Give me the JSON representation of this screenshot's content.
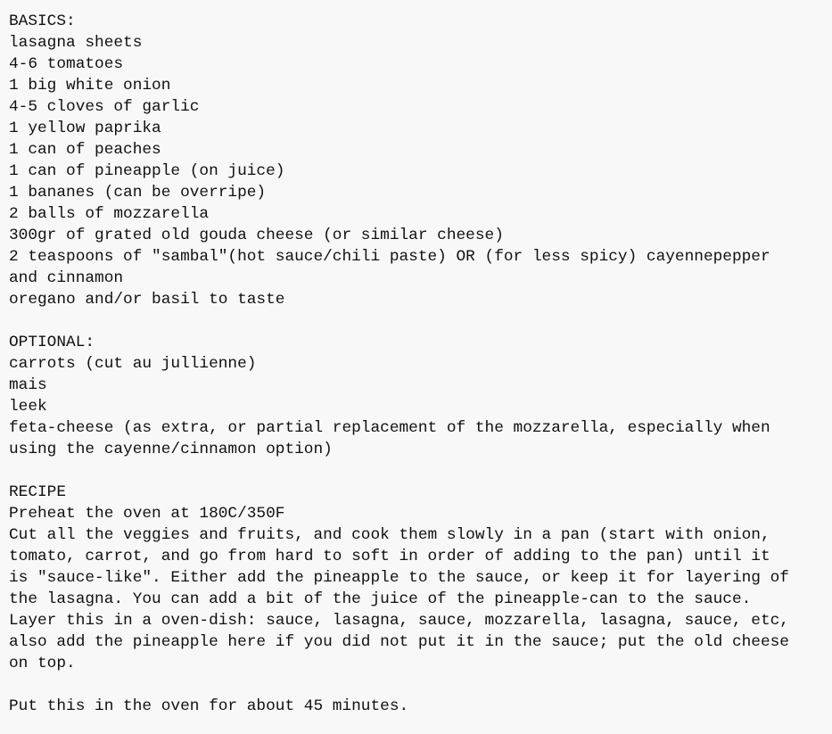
{
  "document": {
    "lines": [
      "BASICS:",
      "lasagna sheets",
      "4-6 tomatoes",
      "1 big white onion",
      "4-5 cloves of garlic",
      "1 yellow paprika",
      "1 can of peaches",
      "1 can of pineapple (on juice)",
      "1 bananes (can be overripe)",
      "2 balls of mozzarella",
      "300gr of grated old gouda cheese (or similar cheese)",
      "2 teaspoons of \"sambal\"(hot sauce/chili paste) OR (for less spicy) cayennepepper",
      "and cinnamon",
      "oregano and/or basil to taste",
      "",
      "OPTIONAL:",
      "carrots (cut au jullienne)",
      "mais",
      "leek",
      "feta-cheese (as extra, or partial replacement of the mozzarella, especially when",
      "using the cayenne/cinnamon option)",
      "",
      "RECIPE",
      "Preheat the oven at 180C/350F",
      "Cut all the veggies and fruits, and cook them slowly in a pan (start with onion,",
      "tomato, carrot, and go from hard to soft in order of adding to the pan) until it",
      "is \"sauce-like\". Either add the pineapple to the sauce, or keep it for layering of",
      "the lasagna. You can add a bit of the juice of the pineapple-can to the sauce.",
      "Layer this in a oven-dish: sauce, lasagna, sauce, mozzarella, lasagna, sauce, etc,",
      "also add the pineapple here if you did not put it in the sauce; put the old cheese",
      "on top.",
      "",
      "Put this in the oven for about 45 minutes."
    ]
  }
}
